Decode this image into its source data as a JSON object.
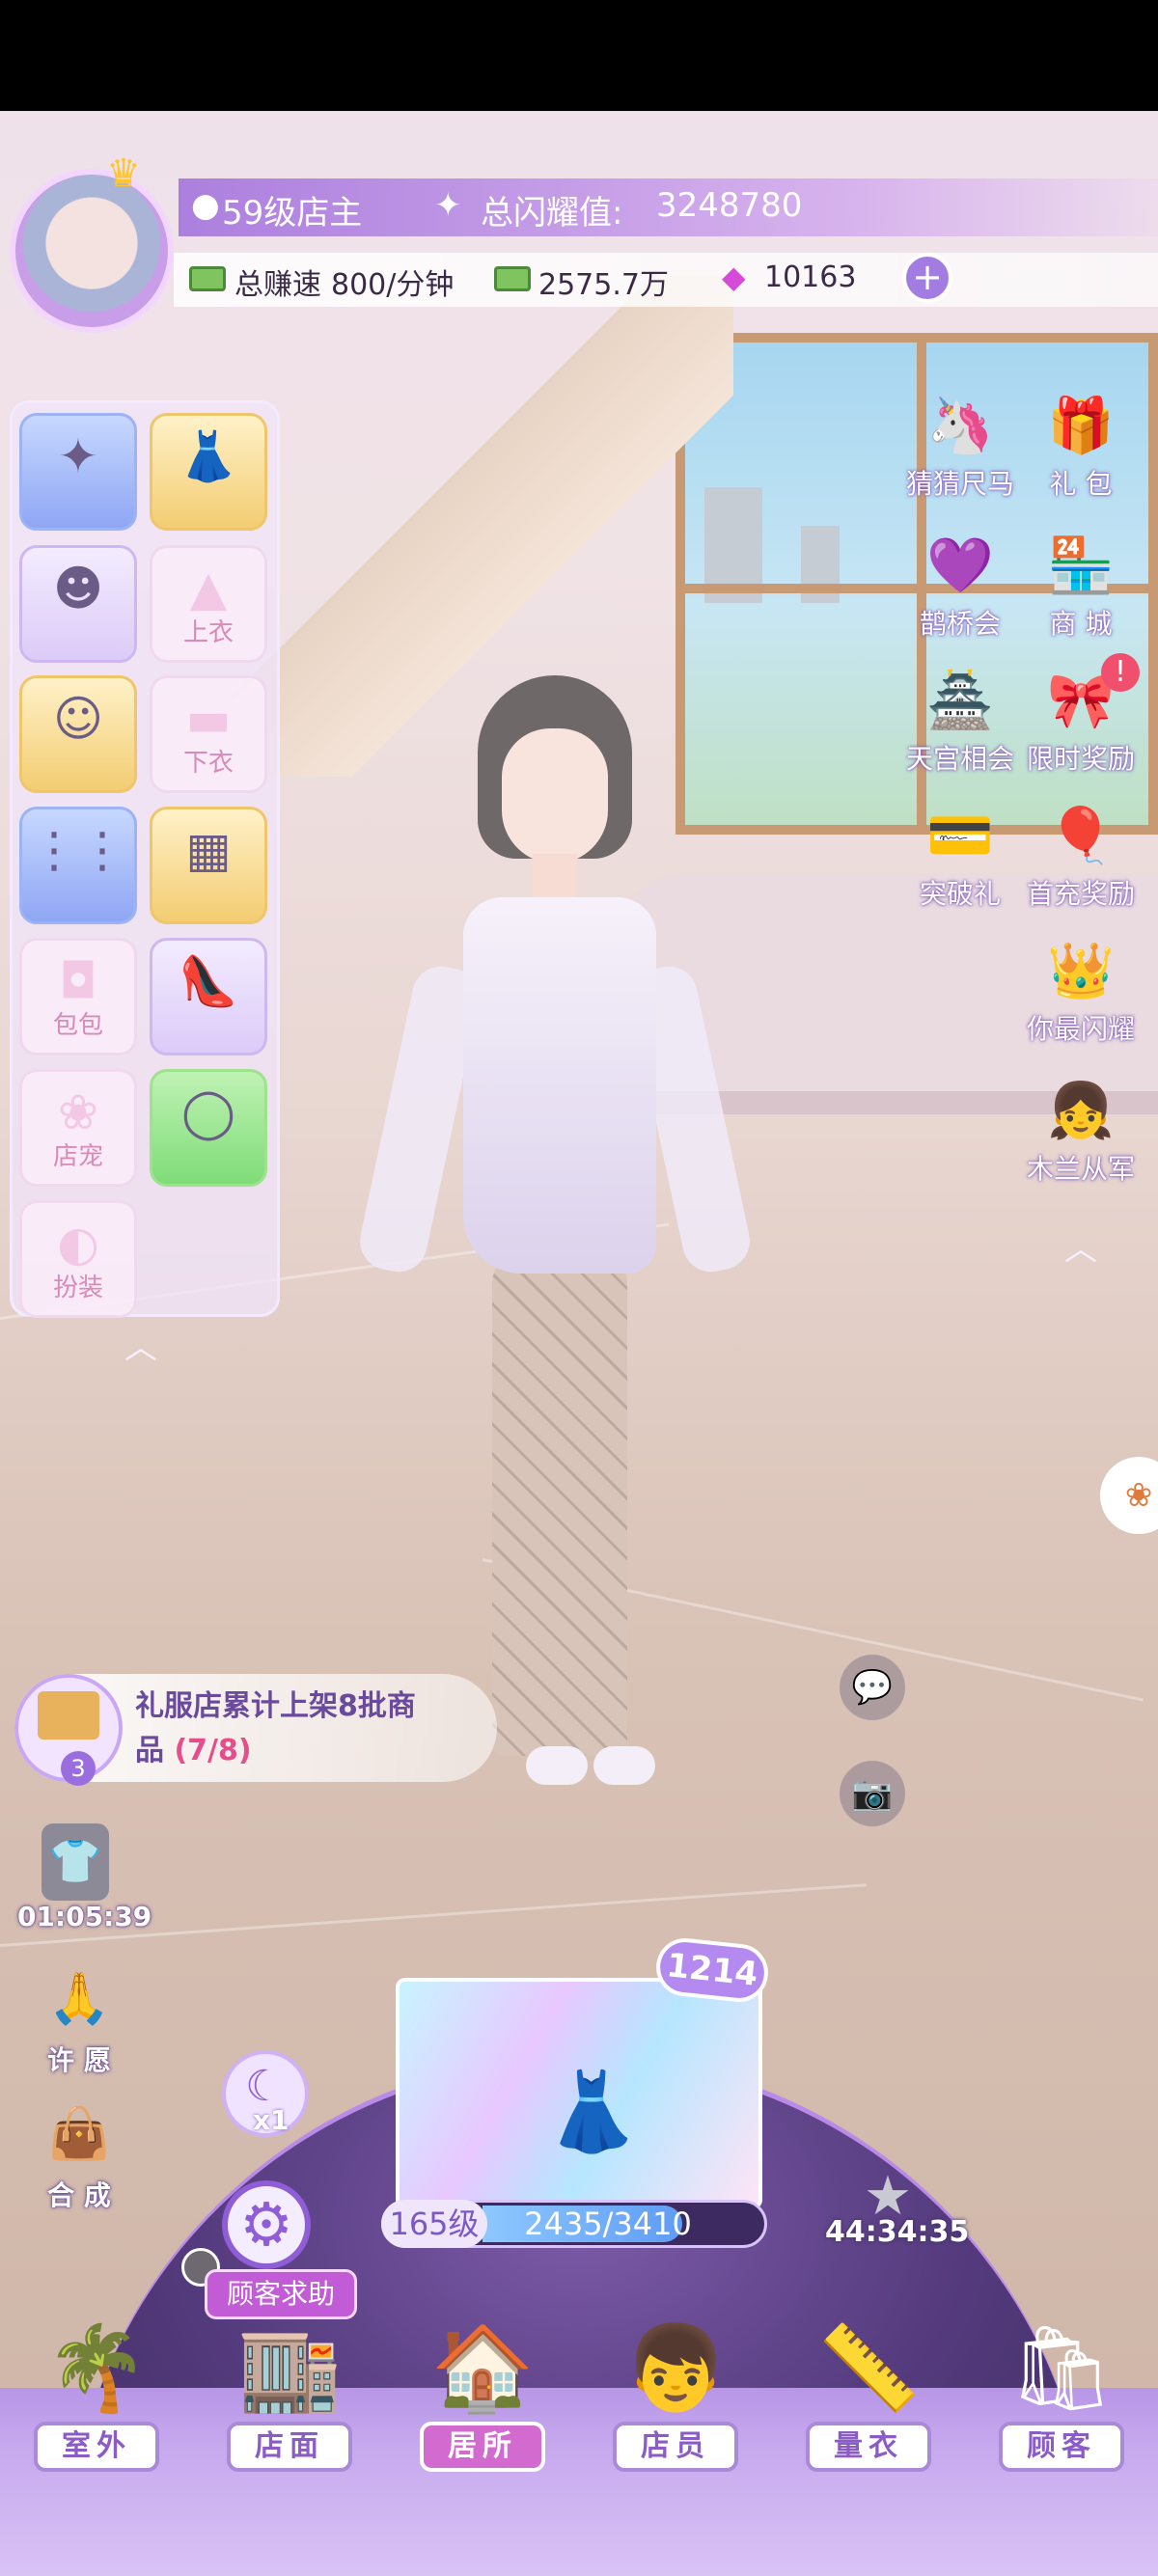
{
  "hud": {
    "level_text": "59级店主",
    "shine_label": "总闪耀值:",
    "shine_value": "3248780",
    "earn_label": "总赚速",
    "earn_value": "800/分钟",
    "cash_value": "2575.7万",
    "gem_value": "10163",
    "plus": "+"
  },
  "wardrobe": {
    "slots": [
      {
        "icon": "wand-icon",
        "glyph": "✦",
        "label": ""
      },
      {
        "icon": "dress-icon",
        "glyph": "👗",
        "label": ""
      },
      {
        "icon": "hair-icon",
        "glyph": "☻",
        "label": ""
      },
      {
        "icon": "top-icon",
        "glyph": "",
        "label": "上衣"
      },
      {
        "icon": "face-icon",
        "glyph": "☺",
        "label": ""
      },
      {
        "icon": "bottom-icon",
        "glyph": "",
        "label": "下衣"
      },
      {
        "icon": "earring-icon",
        "glyph": "⋮",
        "label": ""
      },
      {
        "icon": "stockings-icon",
        "glyph": "▦",
        "label": ""
      },
      {
        "icon": "bag-icon",
        "glyph": "",
        "label": "包包"
      },
      {
        "icon": "shoes-icon",
        "glyph": "👠",
        "label": ""
      },
      {
        "icon": "pet-icon",
        "glyph": "",
        "label": "店宠"
      },
      {
        "icon": "bracelet-icon",
        "glyph": "◯",
        "label": ""
      },
      {
        "icon": "mask-icon",
        "glyph": "",
        "label": "扮装"
      }
    ]
  },
  "right_icons": [
    {
      "name": "guess-size",
      "label": "猜猜尺马",
      "glyph": "🦄"
    },
    {
      "name": "gift-pack",
      "label": "礼 包",
      "glyph": "🎁"
    },
    {
      "name": "magpie-bridge",
      "label": "鹊桥会",
      "glyph": "💜"
    },
    {
      "name": "mall",
      "label": "商 城",
      "glyph": "🏪"
    },
    {
      "name": "heaven-meet",
      "label": "天宫相会",
      "glyph": "🏯"
    },
    {
      "name": "limited-reward",
      "label": "限时奖励",
      "glyph": "🎀"
    },
    {
      "name": "breakthrough-gift",
      "label": "突破礼",
      "glyph": "💳"
    },
    {
      "name": "first-recharge",
      "label": "首充奖励",
      "glyph": "🎈"
    },
    {
      "name": "you-shine",
      "label": "你最闪耀",
      "glyph": "👑"
    },
    {
      "name": "mulan",
      "label": "木兰从军",
      "glyph": "👧"
    }
  ],
  "task": {
    "count": "3",
    "line1": "礼服店累计上架8批商",
    "line2_prefix": "品 ",
    "progress": "(7/8)"
  },
  "left_side": {
    "timer": "01:05:39",
    "wish": "许 愿",
    "synth": "合 成"
  },
  "stage": {
    "box_count": "1214",
    "level": "165级",
    "progress_text": "2435/3410",
    "progress_fraction": 0.714,
    "timer": "44:34:35",
    "potion_count": "x1",
    "help_label": "顾客求助"
  },
  "nav": [
    {
      "key": "outdoor",
      "label": "室外",
      "glyph": "🌴"
    },
    {
      "key": "storefront",
      "label": "店面",
      "glyph": "🏬"
    },
    {
      "key": "residence",
      "label": "居所",
      "glyph": "🏠"
    },
    {
      "key": "staff",
      "label": "店员",
      "glyph": "👦"
    },
    {
      "key": "measure",
      "label": "量衣",
      "glyph": "📏"
    },
    {
      "key": "customer",
      "label": "顾客",
      "glyph": "🛍"
    }
  ],
  "colors": {
    "accent": "#a27ce0",
    "active_nav": "#d36ad0",
    "gem": "#d64ad8"
  }
}
